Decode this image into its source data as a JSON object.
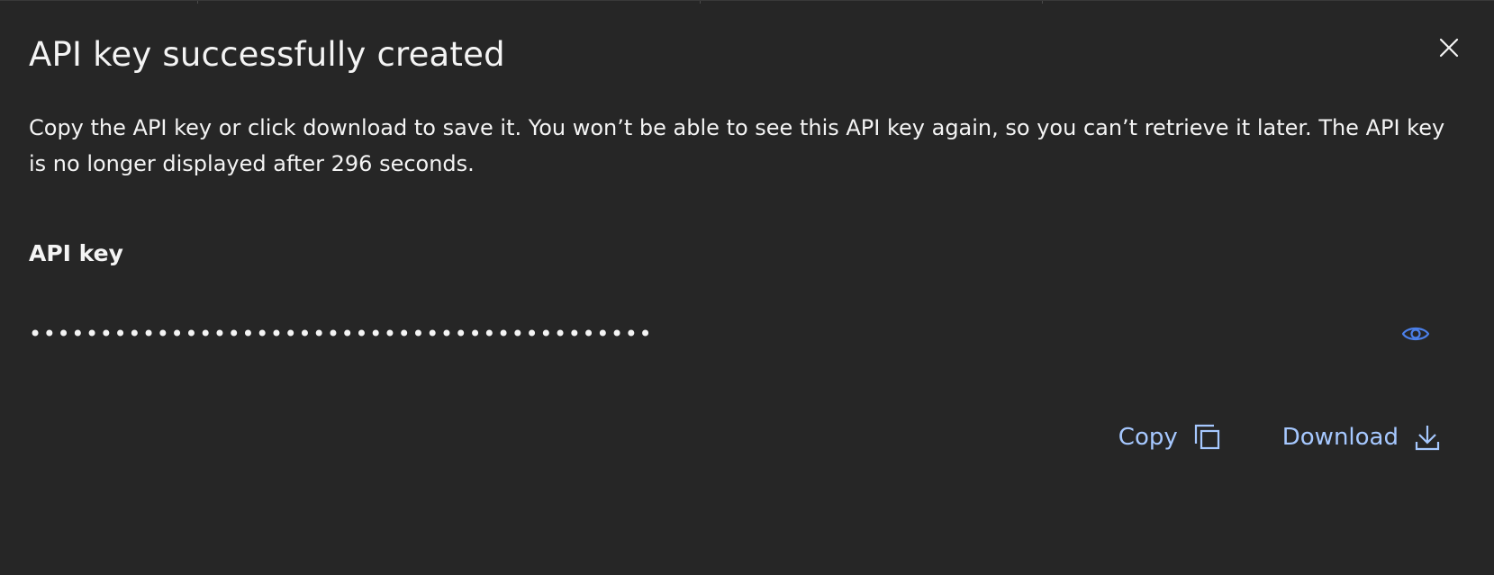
{
  "dialog": {
    "title": "API key successfully created",
    "description": "Copy the API key or click download to save it. You won’t be able to see this API key again, so you can’t retrieve it later. The API key is no longer displayed after 296 seconds.",
    "close_icon": "close-icon"
  },
  "api_key": {
    "label": "API key",
    "masked_value": "••••••••••••••••••••••••••••••••••••••••••••",
    "visibility_icon": "eye-icon"
  },
  "actions": {
    "copy_label": "Copy",
    "copy_icon": "copy-icon",
    "download_label": "Download",
    "download_icon": "download-icon"
  },
  "colors": {
    "background": "#262626",
    "text": "#f4f4f4",
    "link": "#a6c8ff",
    "eye_icon": "#4b7fe8"
  }
}
